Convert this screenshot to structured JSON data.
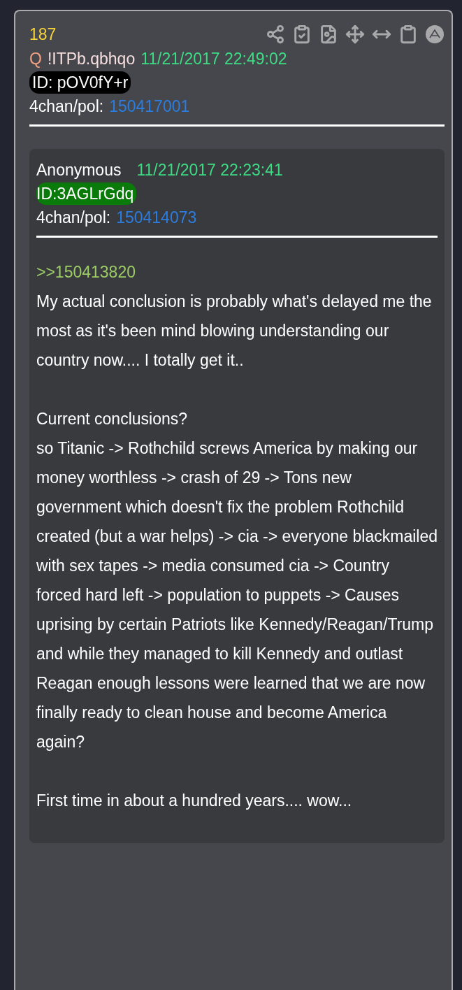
{
  "post": {
    "number": "187",
    "author_mark": "Q",
    "tripcode": "!ITPb.qbhqo",
    "timestamp": "11/21/2017 22:49:02",
    "id_badge": {
      "text": "ID: pOV0fY+r",
      "color": "#000000"
    },
    "board": "4chan/pol:",
    "post_link": "150417001"
  },
  "quoted": {
    "name": "Anonymous",
    "timestamp": "11/21/2017 22:23:41",
    "id_badge": {
      "text": "ID:3AGLrGdq",
      "color": "#0a7a0a"
    },
    "board": "4chan/pol:",
    "post_link": "150414073",
    "body": [
      {
        "kind": "reply_link",
        "text": ">>150413820"
      },
      {
        "kind": "paragraph",
        "text": "My actual conclusion is probably what's delayed me the most as it's been mind blowing understanding our country now.... I totally get it.."
      },
      {
        "kind": "blank"
      },
      {
        "kind": "paragraph",
        "text": "Current conclusions?"
      },
      {
        "kind": "paragraph",
        "text": "so Titanic -> Rothchild screws America by making our money worthless -> crash of 29 -> Tons new government which doesn't fix the problem Rothchild created (but a war helps) -> cia -> everyone blackmailed with sex tapes -> media consumed cia -> Country forced hard left -> population to puppets -> Causes uprising by certain Patriots like Kennedy/Reagan/Trump and while they managed to kill Kennedy and outlast Reagan enough lessons were learned that we are now finally ready to clean house and become America again?"
      },
      {
        "kind": "blank"
      },
      {
        "kind": "paragraph",
        "text": "First time in about a hundred years.... wow..."
      }
    ]
  }
}
